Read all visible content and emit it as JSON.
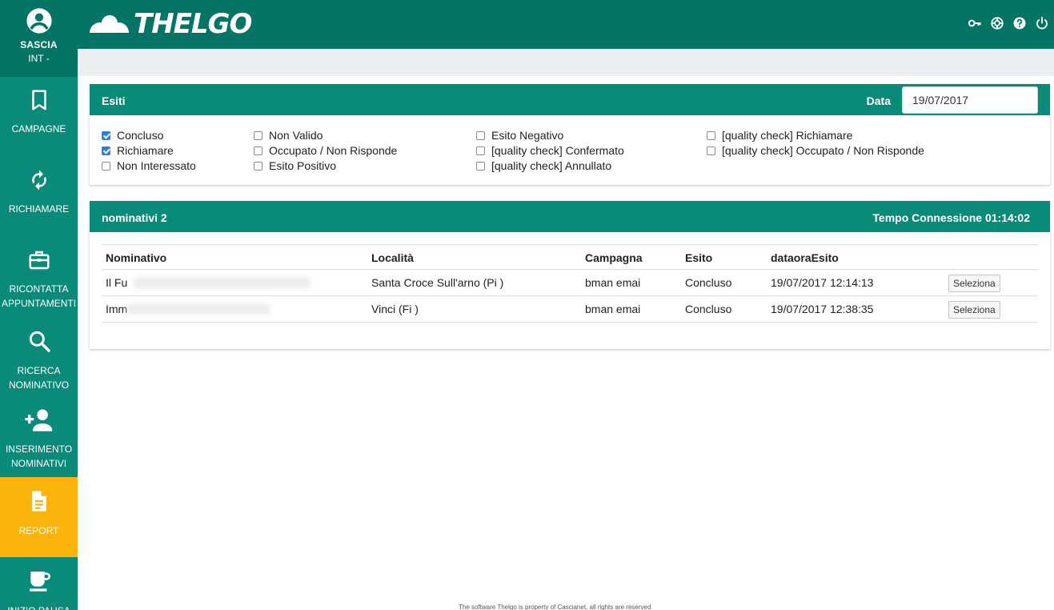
{
  "app": {
    "logo_text": "THELGO"
  },
  "user": {
    "name": "SASCIA",
    "role": "INT -"
  },
  "sidebar": {
    "items": [
      {
        "label": "CAMPAGNE",
        "icon": "bookmark-icon"
      },
      {
        "label": "RICHIAMARE",
        "icon": "refresh-icon"
      },
      {
        "label": "RICONTATTA\nAPPUNTAMENTI",
        "icon": "briefcase-icon"
      },
      {
        "label": "RICERCA\nNOMINATIVO",
        "icon": "search-icon"
      },
      {
        "label": "INSERIMENTO\nNOMINATIVI",
        "icon": "person-add-icon"
      },
      {
        "label": "REPORT",
        "icon": "document-icon",
        "active": true
      },
      {
        "label": "INIZIO PAUSA",
        "icon": "coffee-icon"
      }
    ]
  },
  "header": {
    "icons": [
      "key-icon",
      "support-icon",
      "help-icon",
      "power-icon"
    ]
  },
  "esiti": {
    "title": "Esiti",
    "date_label": "Data",
    "date_value": "19/07/2017",
    "checkboxes": [
      {
        "label": "Concluso",
        "checked": true
      },
      {
        "label": "Richiamare",
        "checked": true
      },
      {
        "label": "Non Interessato",
        "checked": false
      },
      {
        "label": "Non Valido",
        "checked": false
      },
      {
        "label": "Occupato / Non Risponde",
        "checked": false
      },
      {
        "label": "Esito Positivo",
        "checked": false
      },
      {
        "label": "Esito Negativo",
        "checked": false
      },
      {
        "label": "[quality check] Confermato",
        "checked": false
      },
      {
        "label": "[quality check] Annullato",
        "checked": false
      },
      {
        "label": "[quality check] Richiamare",
        "checked": false
      },
      {
        "label": "[quality check] Occupato / Non Risponde",
        "checked": false
      }
    ]
  },
  "nominativi": {
    "title": "nominativi 2",
    "tempo": "Tempo Connessione 01:14:02",
    "columns": [
      "Nominativo",
      "Località",
      "Campagna",
      "Esito",
      "dataoraEsito"
    ],
    "rows": [
      {
        "nominativo": "Il Fu",
        "localita": "Santa Croce Sull'arno (Pi )",
        "campagna": "bman emai",
        "esito": "Concluso",
        "data": "19/07/2017 12:14:13",
        "action": "Seleziona"
      },
      {
        "nominativo": "Imm",
        "localita": "Vinci (Fi )",
        "campagna": "bman emai",
        "esito": "Concluso",
        "data": "19/07/2017 12:38:35",
        "action": "Seleziona"
      }
    ]
  },
  "footer": {
    "text": "The software Thelgo is property of Cascianet, all rights are reserved"
  },
  "colors": {
    "primary": "#0a8a79",
    "primary_dark": "#047565",
    "accent": "#fbb40b",
    "checkbox": "#2b7de9"
  }
}
